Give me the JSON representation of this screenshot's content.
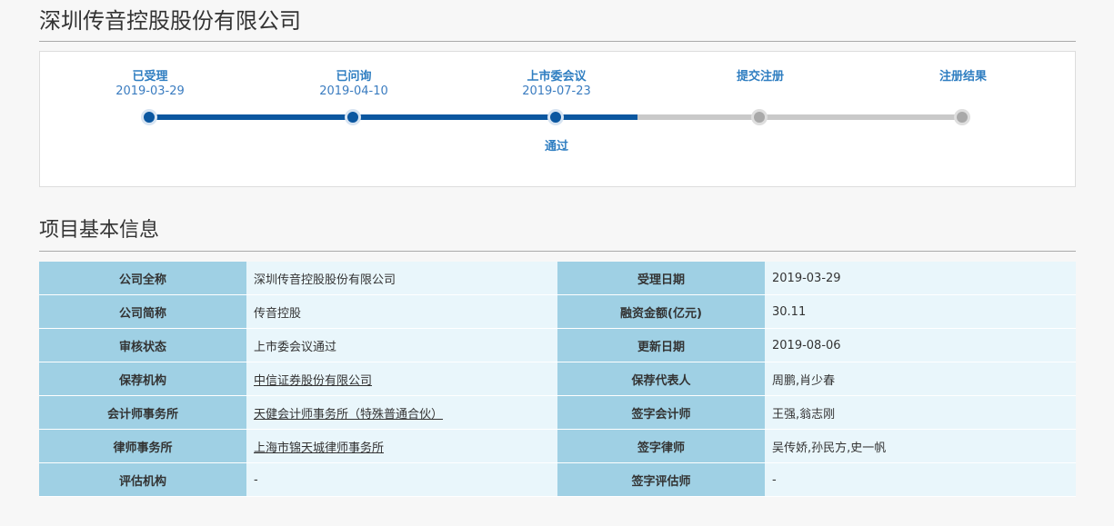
{
  "company_title": "深圳传音控股股份有限公司",
  "progress": {
    "steps": [
      {
        "label": "已受理",
        "date": "2019-03-29",
        "status": "done",
        "note": ""
      },
      {
        "label": "已问询",
        "date": "2019-04-10",
        "status": "done",
        "note": ""
      },
      {
        "label": "上市委会议",
        "date": "2019-07-23",
        "status": "done",
        "note": "通过"
      },
      {
        "label": "提交注册",
        "date": "",
        "status": "pending",
        "note": ""
      },
      {
        "label": "注册结果",
        "date": "",
        "status": "pending",
        "note": ""
      }
    ],
    "completed_fraction": 0.6,
    "colors": {
      "done": "#0b57a0",
      "pending": "#c9c9c9",
      "label": "#2f7ec1"
    }
  },
  "section_title": "项目基本信息",
  "info_table": {
    "rows": [
      {
        "k1": "公司全称",
        "v1": "深圳传音控股股份有限公司",
        "link1": false,
        "k2": "受理日期",
        "v2": "2019-03-29"
      },
      {
        "k1": "公司简称",
        "v1": "传音控股",
        "link1": false,
        "k2": "融资金额(亿元)",
        "v2": "30.11"
      },
      {
        "k1": "审核状态",
        "v1": "上市委会议通过",
        "link1": false,
        "k2": "更新日期",
        "v2": "2019-08-06"
      },
      {
        "k1": "保荐机构",
        "v1": "中信证券股份有限公司",
        "link1": true,
        "k2": "保荐代表人",
        "v2": "周鹏,肖少春"
      },
      {
        "k1": "会计师事务所",
        "v1": "天健会计师事务所（特殊普通合伙）",
        "link1": true,
        "k2": "签字会计师",
        "v2": "王强,翁志刚"
      },
      {
        "k1": "律师事务所",
        "v1": "上海市锦天城律师事务所",
        "link1": true,
        "k2": "签字律师",
        "v2": "吴传娇,孙民方,史一帆"
      },
      {
        "k1": "评估机构",
        "v1": "-",
        "link1": false,
        "k2": "签字评估师",
        "v2": "-"
      }
    ],
    "colors": {
      "key_bg": "#9fd0e4",
      "value_bg": "#e9f6fb"
    }
  }
}
